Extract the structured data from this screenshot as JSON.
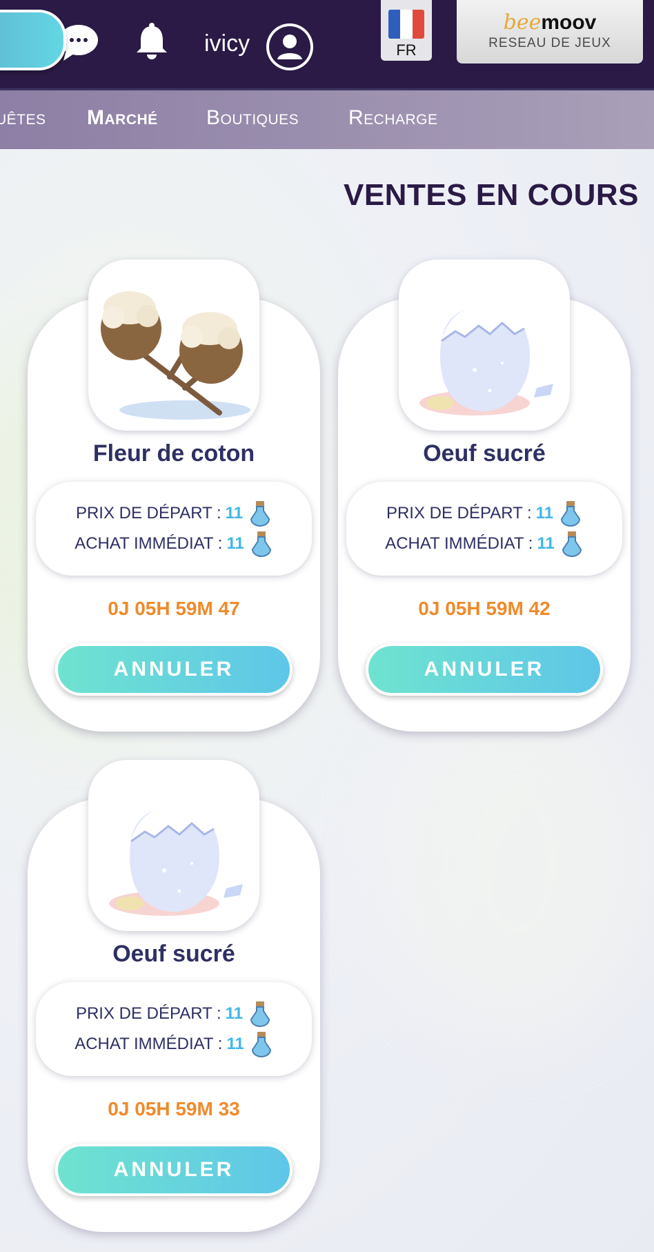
{
  "header": {
    "username": "ivicy",
    "language": "FR",
    "partner": {
      "brand_script": "bee",
      "brand_bold": "moov",
      "subtitle": "RESEAU DE JEUX"
    },
    "icons": {
      "chat": "chat-bubble-icon",
      "notifications": "bell-icon",
      "profile": "user-avatar-icon"
    }
  },
  "nav": {
    "items": [
      {
        "label": "uêtes",
        "active": false
      },
      {
        "label": "Marché",
        "active": true
      },
      {
        "label": "Boutiques",
        "active": false
      },
      {
        "label": "Recharge",
        "active": false
      }
    ]
  },
  "page": {
    "title": "VENTES EN COURS"
  },
  "labels": {
    "start_price": "PRIX DE DÉPART :",
    "buy_now": "ACHAT IMMÉDIAT :",
    "cancel": "ANNULER"
  },
  "listings": [
    {
      "name": "Fleur de coton",
      "image": "cotton-flower-icon",
      "start_price": "11",
      "buy_now_price": "11",
      "currency_icon": "potion-icon",
      "timer": "0J 05H 59M 47"
    },
    {
      "name": "Oeuf sucré",
      "image": "sugar-egg-icon",
      "start_price": "11",
      "buy_now_price": "11",
      "currency_icon": "potion-icon",
      "timer": "0J 05H 59M 42"
    },
    {
      "name": "Oeuf sucré",
      "image": "sugar-egg-icon",
      "start_price": "11",
      "buy_now_price": "11",
      "currency_icon": "potion-icon",
      "timer": "0J 05H 59M 33"
    }
  ],
  "colors": {
    "header_bg": "#2a1a45",
    "nav_bg": "#9a8eb0",
    "title": "#2a1a45",
    "item_name": "#2e2f63",
    "price_value": "#3fb7e8",
    "timer": "#ef8a2a",
    "button_gradient_start": "#6fe3cf",
    "button_gradient_end": "#5ec6e8"
  }
}
